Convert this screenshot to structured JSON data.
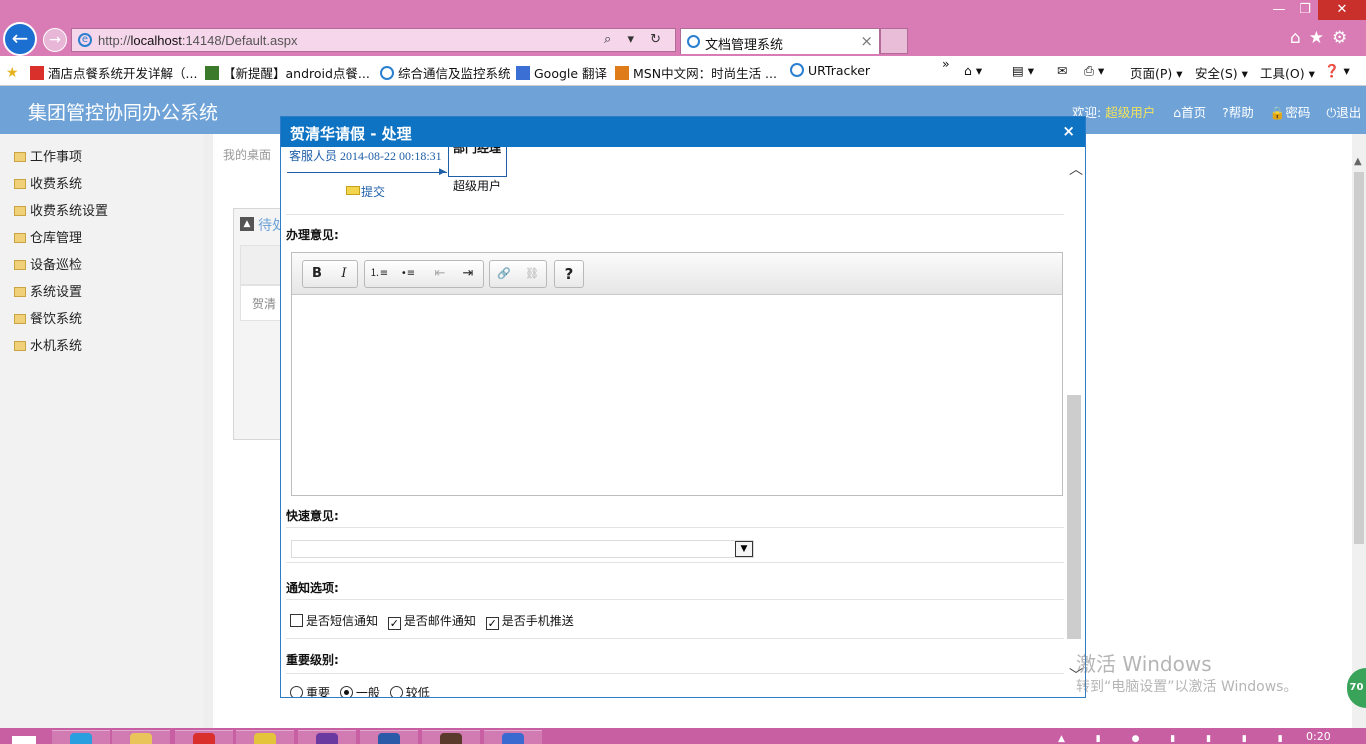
{
  "browser": {
    "url_prefix": "http://",
    "url_host": "localhost",
    "url_rest": ":14148/Default.aspx",
    "address_tools": "⌕ ▾ ↻",
    "tab_title": "文档管理系统",
    "tab_close": "×",
    "back_icon": "←",
    "forward_icon": "→",
    "right_icons": "⌂★⚙",
    "win_min": "—",
    "win_max": "❐",
    "win_close": "✕",
    "favorites": [
      {
        "label": "酒店点餐系统开发详解（...",
        "icon_color": "#d9302c"
      },
      {
        "label": "【新提醒】android点餐...",
        "icon_color": "#3a7a2a"
      },
      {
        "label": "综合通信及监控系统",
        "icon_color": "#2a7fd0"
      },
      {
        "label": "Google 翻译",
        "icon_color": "#3b6fd4"
      },
      {
        "label": "MSN中文网：时尚生活 ...",
        "icon_color": "#e07b1a"
      },
      {
        "label": "URTracker",
        "icon_color": "#2a7fd0"
      }
    ],
    "fav_more": "»",
    "commands": {
      "home": "⌂ ▾",
      "feeds": "▤ ▾",
      "mail": "✉",
      "print": "⎙ ▾",
      "page": "页面(P) ▾",
      "safety": "安全(S) ▾",
      "tools": "工具(O) ▾",
      "help": "❓ ▾"
    }
  },
  "header": {
    "title": "集团管控协同办公系统",
    "welcome": "欢迎:",
    "user": "超级用户",
    "home": "⌂首页",
    "help": "?帮助",
    "password": "🔒密码",
    "logout": "⏻退出"
  },
  "sidebar": {
    "items": [
      "工作事项",
      "收费系统",
      "收费系统设置",
      "仓库管理",
      "设备巡检",
      "系统设置",
      "餐饮系统",
      "水机系统"
    ]
  },
  "background": {
    "crumb": "我的桌面",
    "panel_title": "待处",
    "panel_collapse_icon": "▲",
    "row_cell": "贺清"
  },
  "modal": {
    "title": "贺清华请假 - 处理",
    "close": "×",
    "flow": {
      "actor": "客服人员",
      "time": "2014-08-22 00:18:31",
      "node_label": "部门经理",
      "node_user": "超级用户",
      "submit": "提交"
    },
    "opinion_label": "办理意见:",
    "toolbar": {
      "bold": "B",
      "italic": "I",
      "ordered_list": "⒈≡",
      "bullet_list": "•≡",
      "outdent": "⇤",
      "indent": "⇥",
      "link": "🔗",
      "unlink": "⛓",
      "help": "?"
    },
    "quick_label": "快速意见:",
    "quick_value": "",
    "quick_arrow": "▼",
    "notify_label": "通知选项:",
    "notify": [
      {
        "label": "是否短信通知",
        "checked": false
      },
      {
        "label": "是否邮件通知",
        "checked": true
      },
      {
        "label": "是否手机推送",
        "checked": true
      }
    ],
    "level_label": "重要级别:",
    "levels": [
      {
        "label": "重要",
        "selected": false
      },
      {
        "label": "一般",
        "selected": true
      },
      {
        "label": "较低",
        "selected": false
      }
    ],
    "scroll_up": "︿",
    "scroll_down": "﹀"
  },
  "watermark": {
    "line1": "激活 Windows",
    "line2": "转到“电脑设置”以激活 Windows。"
  },
  "badge": "70",
  "taskbar": {
    "time": "0:20"
  }
}
